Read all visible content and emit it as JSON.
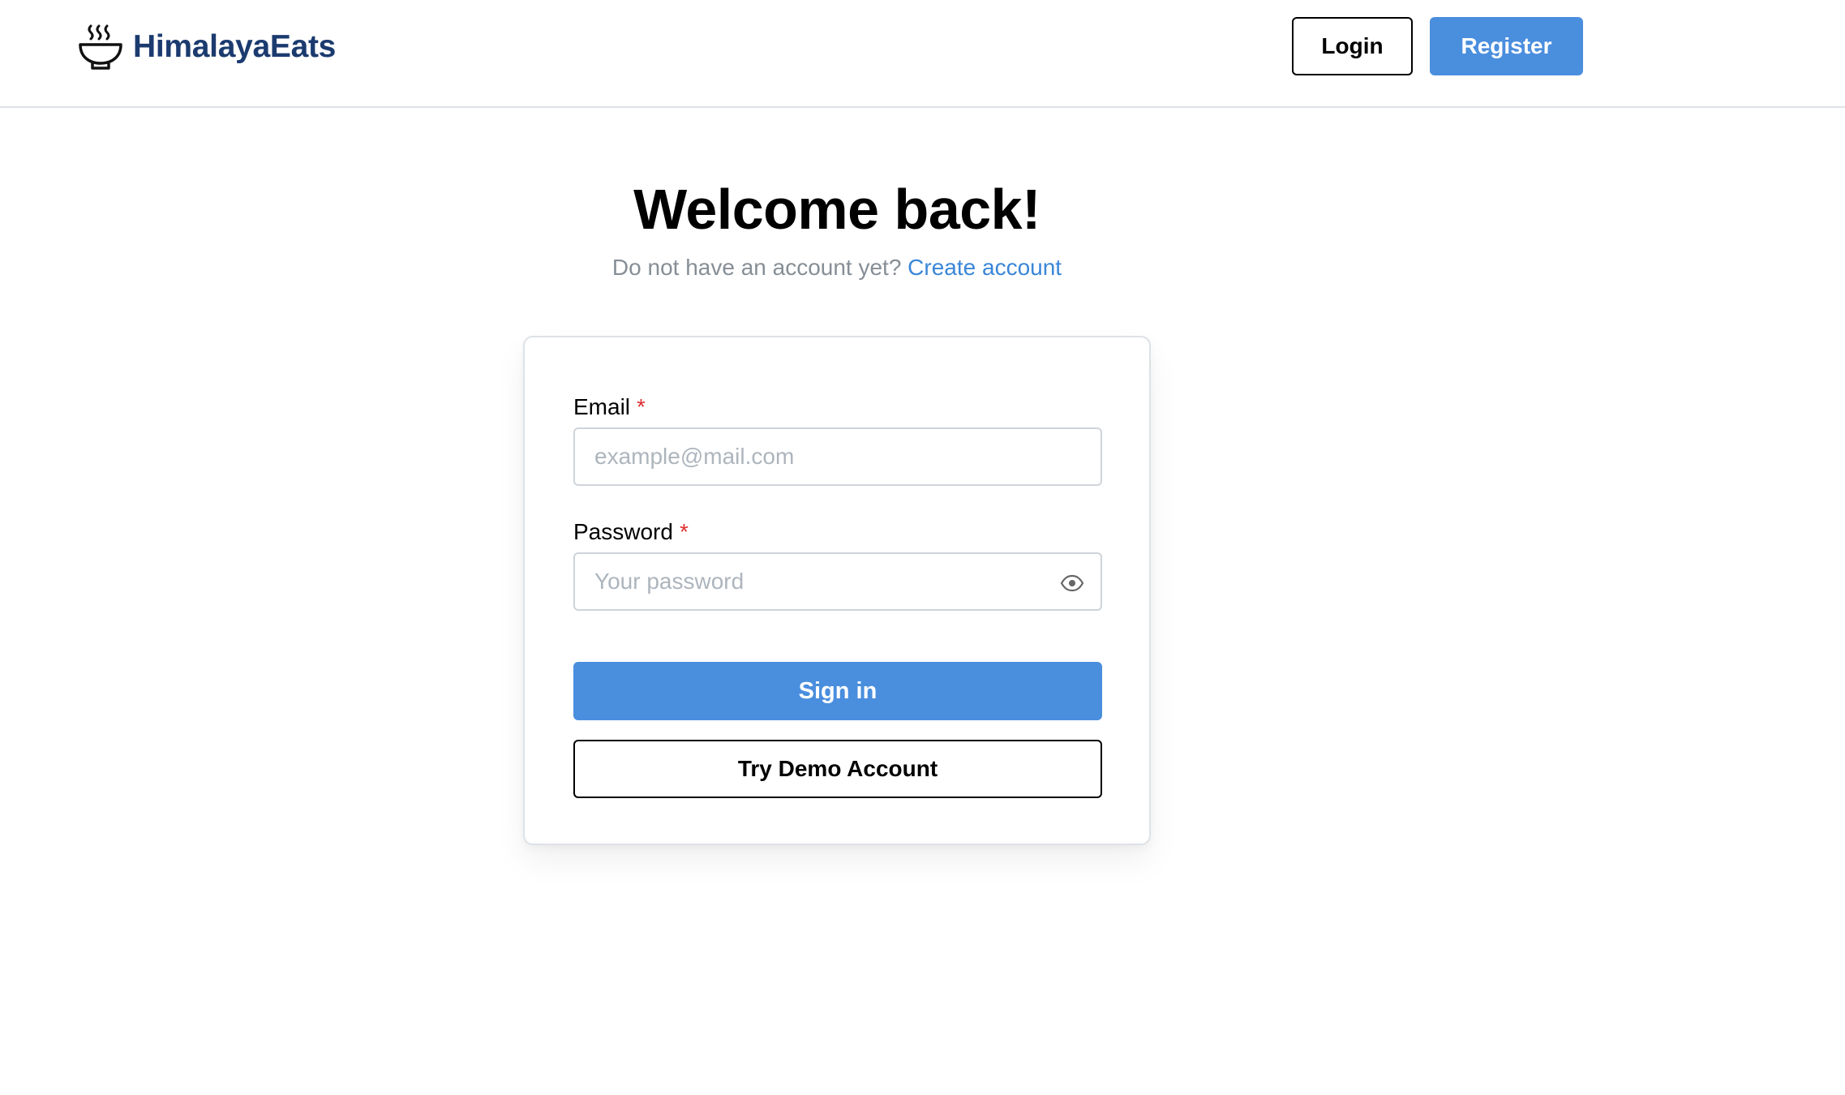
{
  "header": {
    "brand_name": "HimalayaEats",
    "brand_icon": "steaming-bowl-icon",
    "login_label": "Login",
    "register_label": "Register"
  },
  "main": {
    "title": "Welcome back!",
    "subtitle_text": "Do not have an account yet?",
    "subtitle_link": "Create account"
  },
  "form": {
    "email": {
      "label": "Email",
      "required_mark": "*",
      "placeholder": "example@mail.com",
      "value": ""
    },
    "password": {
      "label": "Password",
      "required_mark": "*",
      "placeholder": "Your password",
      "value": "",
      "toggle_icon": "eye-icon"
    },
    "signin_label": "Sign in",
    "demo_label": "Try Demo Account"
  },
  "colors": {
    "primary": "#4a8ede",
    "brand_text": "#1b3b6f",
    "link": "#3a86d8",
    "required": "#e03131",
    "muted_text": "#868e96"
  }
}
